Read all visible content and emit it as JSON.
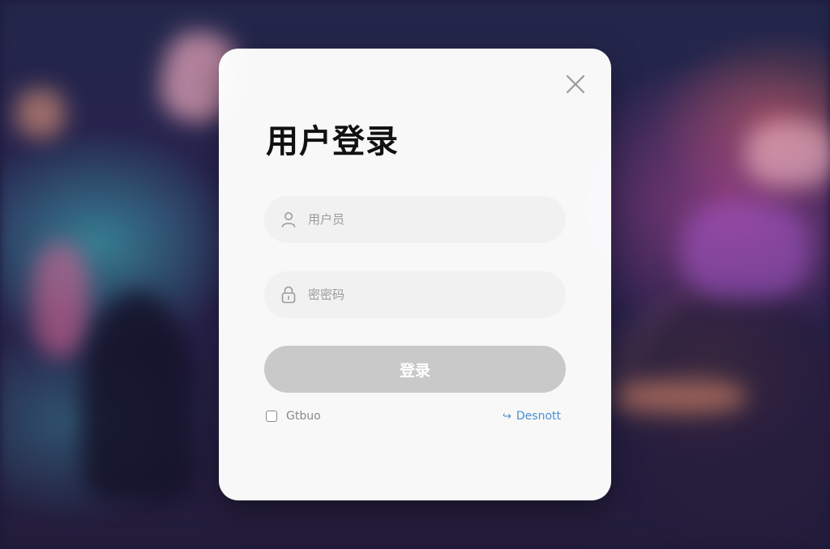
{
  "login_dialog": {
    "title": "用户登录",
    "username": {
      "placeholder": "用户员",
      "value": ""
    },
    "password": {
      "placeholder": "密密码",
      "value": ""
    },
    "login_button_label": "登录",
    "remember": {
      "label": "Gtbuo",
      "checked": false
    },
    "forgot_link": {
      "arrow": "↪",
      "label": "Desnott"
    }
  },
  "icons": {
    "close": "close-icon",
    "user": "user-icon",
    "lock": "lock-icon"
  },
  "colors": {
    "dialog_bg": "#ffffff",
    "field_bg": "#f1f1f1",
    "button_bg": "#c9c9c9",
    "link": "#4a8fd1",
    "title": "#111111"
  }
}
